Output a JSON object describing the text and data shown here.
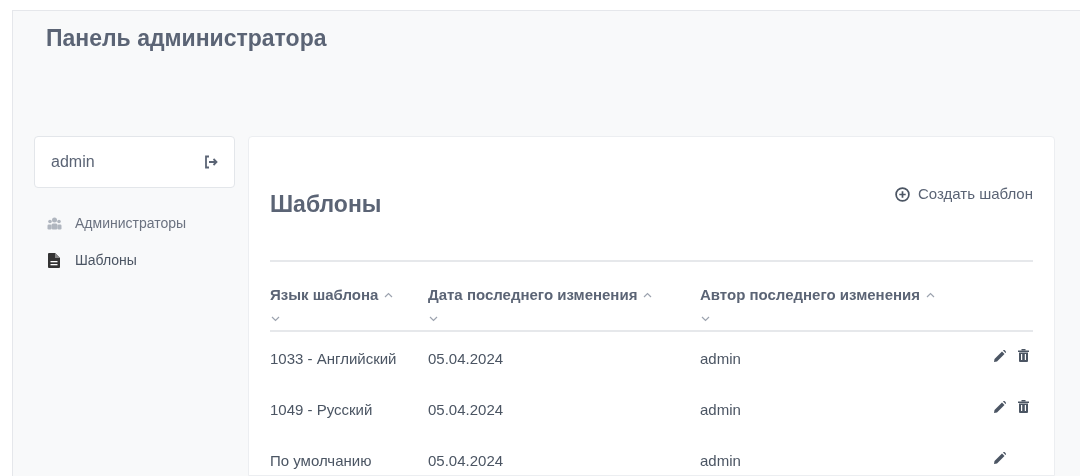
{
  "header": {
    "title": "Панель администратора"
  },
  "user": {
    "name": "admin"
  },
  "sidebar": {
    "items": [
      {
        "label": "Администраторы",
        "kind": "users",
        "selected": false
      },
      {
        "label": "Шаблоны",
        "kind": "file",
        "selected": true
      }
    ]
  },
  "content": {
    "title": "Шаблоны",
    "create_button": "Создать шаблон",
    "table": {
      "columns": [
        "Язык шаблона",
        "Дата последнего изменения",
        "Автор последнего изменения"
      ],
      "rows": [
        {
          "cells": [
            "1033 - Английский",
            "05.04.2024",
            "admin"
          ],
          "deletable": true
        },
        {
          "cells": [
            "1049 - Русский",
            "05.04.2024",
            "admin"
          ],
          "deletable": true
        },
        {
          "cells": [
            "По умолчанию",
            "05.04.2024",
            "admin"
          ],
          "deletable": false
        }
      ]
    }
  }
}
